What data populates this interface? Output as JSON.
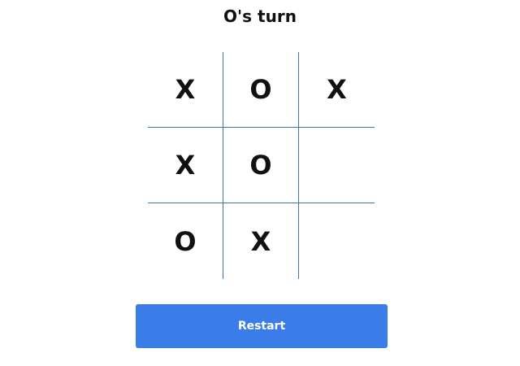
{
  "status": {
    "text": "O's turn"
  },
  "board": {
    "cells": [
      "X",
      "O",
      "X",
      "X",
      "O",
      "",
      "O",
      "X",
      ""
    ]
  },
  "restart": {
    "label": "Restart"
  },
  "colors": {
    "grid_line": "#3c79b0",
    "button_bg": "#3b7de8",
    "button_text": "#ffffff",
    "mark": "#111111"
  }
}
